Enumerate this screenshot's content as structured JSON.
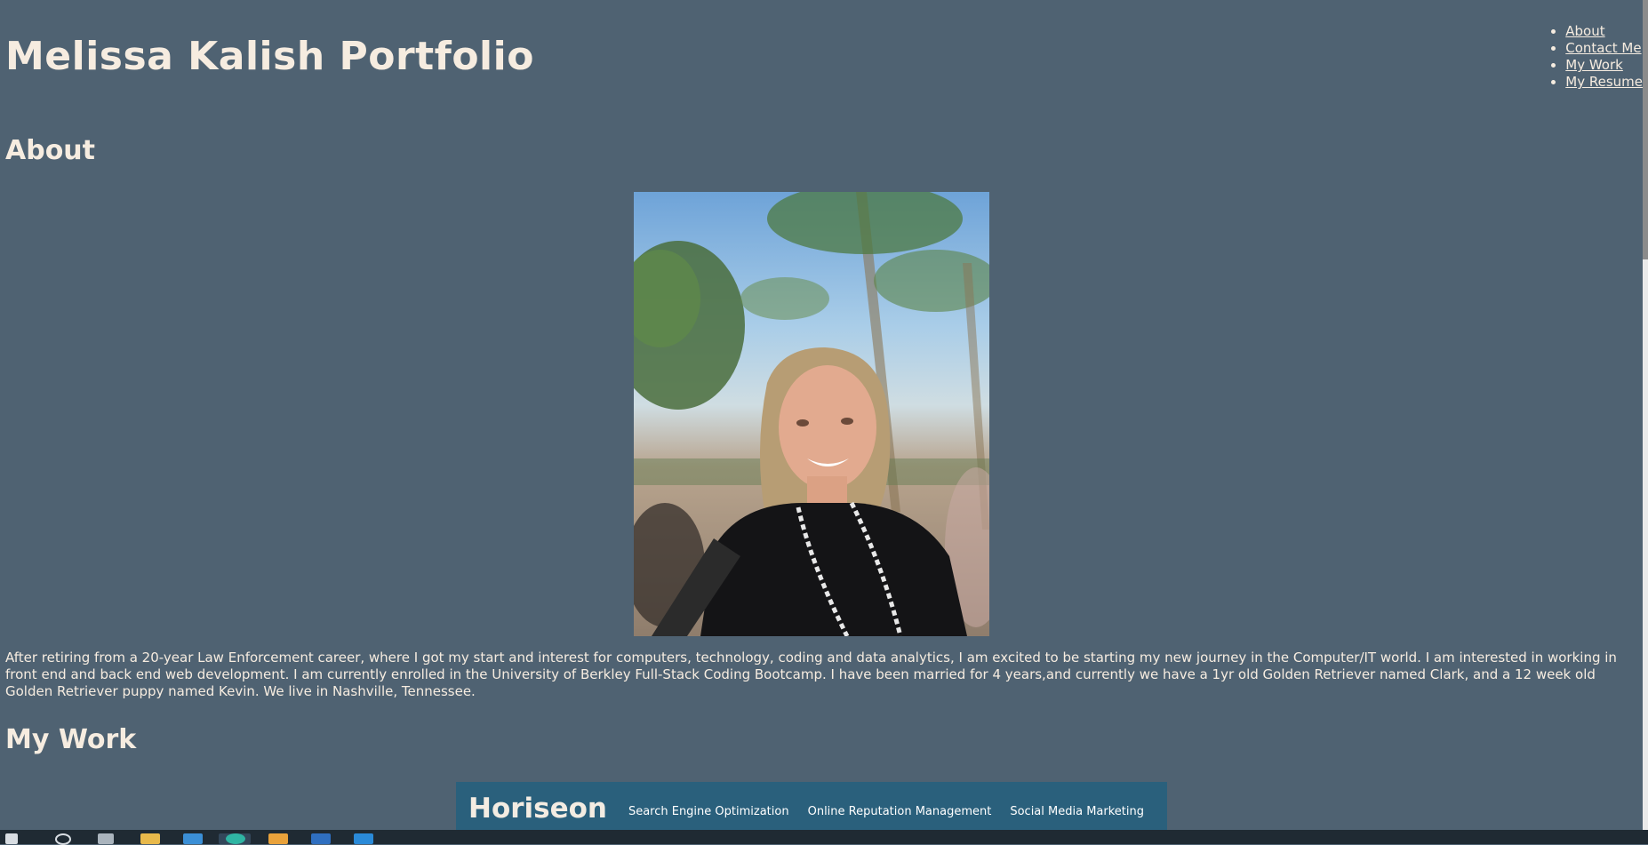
{
  "header": {
    "title": "Melissa Kalish Portfolio",
    "nav": [
      "About",
      "Contact Me",
      "My Work",
      "My Resume"
    ]
  },
  "about": {
    "title": "About",
    "body": "After retiring from a 20-year Law Enforcement career, where I got my start and interest for computers, technology, coding and data analytics, I am excited to be starting my new journey in the Computer/IT world. I am interested in working in front end and back end web development. I am currently enrolled in the University of Berkley Full-Stack Coding Bootcamp. I have been married for 4 years,and currently we have a 1yr old Golden Retriever named Clark, and a 12 week old Golden Retriever puppy named Kevin. We live in Nashville, Tennessee."
  },
  "work": {
    "title": "My Work",
    "preview": {
      "logo": "Horiseon",
      "links": [
        "Search Engine Optimization",
        "Online Reputation Management",
        "Social Media Marketing"
      ]
    }
  },
  "colors": {
    "background": "#4f6272",
    "text": "#f6ece0",
    "preview_bar": "#2a607c",
    "taskbar": "#1f2a33"
  }
}
